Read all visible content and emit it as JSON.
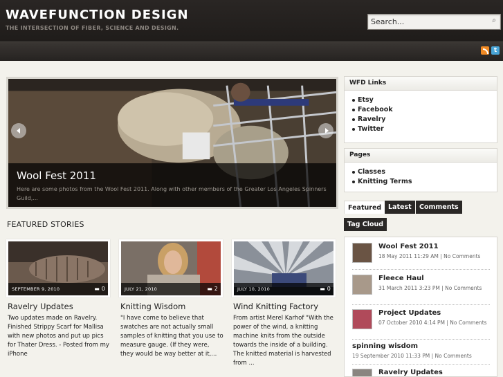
{
  "header": {
    "site_title": "WAVEFUNCTION DESIGN",
    "tagline": "THE INTERSECTION OF FIBER, SCIENCE AND DESIGN.",
    "search_placeholder": "Search..."
  },
  "social": {
    "rss_icon": "rss-icon",
    "twitter_icon": "twitter-icon"
  },
  "slider": {
    "title": "Wool Fest 2011",
    "excerpt": "Here are some photos from the Wool Fest 2011. Along with other members of the Greater Los Angeles Spinners Guild,..."
  },
  "featured": {
    "heading": "FEATURED STORIES",
    "stories": [
      {
        "date": "SEPTEMBER 9, 2010",
        "comments": "0",
        "title": "Ravelry Updates",
        "excerpt": "Two updates made on Ravelry. Finished Strippy Scarf for Mallisa with new photos and put up pics for Thater Dress. - Posted from my iPhone"
      },
      {
        "date": "JULY 21, 2010",
        "comments": "2",
        "title": "Knitting Wisdom",
        "excerpt": "\"I have come to believe that swatches are not actually small samples of knitting that you use to measure gauge. (If they were, they would be way better at it,..."
      },
      {
        "date": "JULY 10, 2010",
        "comments": "0",
        "title": "Wind Knitting Factory",
        "excerpt": "From artist Merel Karhof \"With the power of the wind, a knitting machine knits from the outside towards the inside of a building. The knitted material is harvested from ..."
      }
    ]
  },
  "sidebar": {
    "wfd_links": {
      "title": "WFD Links",
      "items": [
        "Etsy",
        "Facebook",
        "Ravelry",
        "Twitter"
      ]
    },
    "pages": {
      "title": "Pages",
      "items": [
        "Classes",
        "Knitting Terms"
      ]
    },
    "tabs": [
      "Featured",
      "Latest",
      "Comments",
      "Tag Cloud"
    ],
    "posts": [
      {
        "title": "Wool Fest 2011",
        "meta": "18 May 2011 11:29 AM | No Comments"
      },
      {
        "title": "Fleece Haul",
        "meta": "31 March 2011 3:23 PM | No Comments"
      },
      {
        "title": "Project Updates",
        "meta": "07 October 2010 4:14 PM | No Comments"
      },
      {
        "title": "spinning wisdom",
        "meta": "19 September 2010 11:33 PM | No Comments"
      },
      {
        "title": "Ravelry Updates",
        "meta": ""
      }
    ]
  }
}
